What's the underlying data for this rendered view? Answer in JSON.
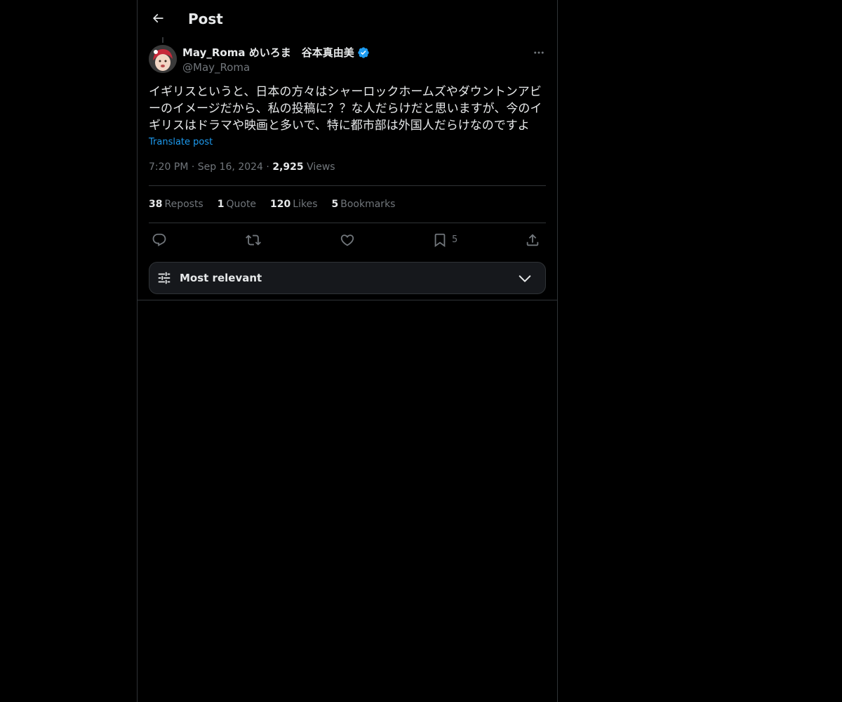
{
  "header": {
    "title": "Post",
    "back_icon": "arrow-left-icon"
  },
  "tweet": {
    "author": {
      "name": "May_Roma めいろま　谷本真由美",
      "handle": "@May_Roma",
      "verified": true,
      "verified_color": "#1d9bf0",
      "avatar_icon": "user-avatar"
    },
    "text": "イギリスというと、日本の方々はシャーロックホームズやダウントンアビーのイメージだから、私の投稿に？？な人だらけだと思いますが、今のイギリスはドラマや映画と多いで、特に都市部は外国人だらけなのですよ",
    "translate_label": "Translate post",
    "time": "7:20 PM",
    "date": "Sep 16, 2024",
    "separator": "·",
    "views_count": "2,925",
    "views_label": "Views"
  },
  "stats": {
    "reposts": {
      "count": "38",
      "label": "Reposts"
    },
    "quotes": {
      "count": "1",
      "label": "Quote"
    },
    "likes": {
      "count": "120",
      "label": "Likes"
    },
    "bookmarks": {
      "count": "5",
      "label": "Bookmarks"
    }
  },
  "actions": {
    "reply_icon": "reply-icon",
    "repost_icon": "repost-icon",
    "like_icon": "heart-icon",
    "bookmark_icon": "bookmark-icon",
    "bookmark_count": "5",
    "share_icon": "share-icon"
  },
  "sort": {
    "label": "Most relevant",
    "icon": "sliders-icon",
    "chevron": "chevron-down-icon"
  },
  "colors": {
    "background": "#000000",
    "text_primary": "#e7e9ea",
    "text_secondary": "#71767b",
    "accent": "#1d9bf0",
    "border": "#2f3336"
  }
}
